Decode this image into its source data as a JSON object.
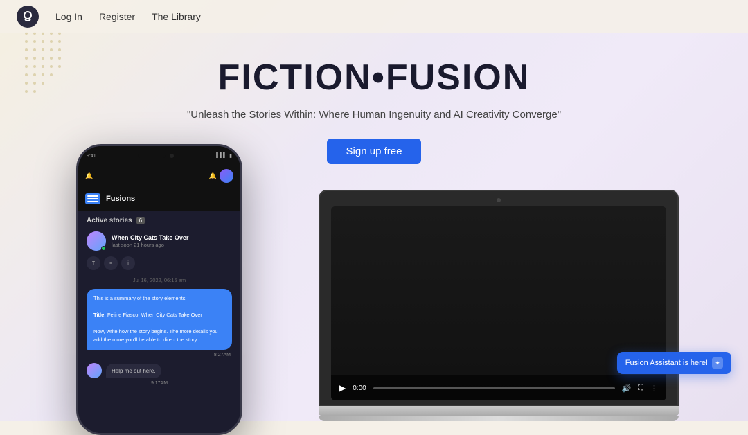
{
  "nav": {
    "logo_alt": "FictionFusion logo",
    "links": [
      {
        "label": "Log In",
        "id": "login"
      },
      {
        "label": "Register",
        "id": "register"
      },
      {
        "label": "The Library",
        "id": "library"
      }
    ]
  },
  "hero": {
    "title": "FICTION•FUSION",
    "subtitle": "\"Unleash the Stories Within: Where Human Ingenuity and AI Creativity Converge\"",
    "cta_label": "Sign up free"
  },
  "phone": {
    "header_title": "Fusions",
    "active_stories_label": "Active stories",
    "active_count": "6",
    "story_name": "When City Cats Take Over",
    "story_time": "last soon 21 hours ago",
    "date_divider": "Jul 16, 2022, 06:15 am",
    "ai_bubble": "This is a summary of the story elements:\n\nTitle: Feline Fiasco: When City Cats Take Over\n\nNow, write how the story begins. The more details you add the more you'll be able to direct the story.",
    "ai_time": "8:27AM",
    "user_message": "Help me out here.",
    "user_time": "9:17AM"
  },
  "laptop": {
    "time_display": "0:00"
  },
  "fusion_badge": {
    "text": "Fusion Assistant is here!",
    "icon": "✦"
  }
}
